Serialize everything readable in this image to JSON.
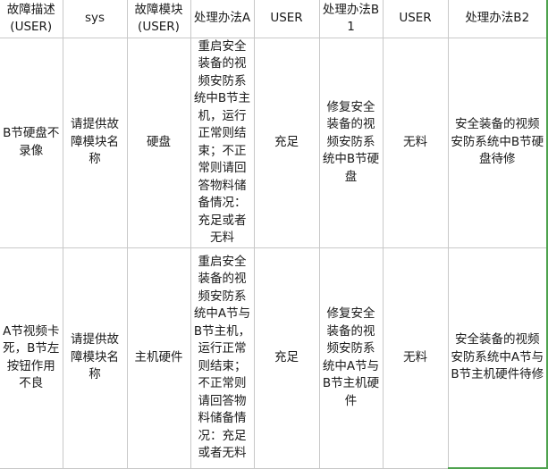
{
  "table": {
    "headers": [
      "故障描述(USER)",
      "sys",
      "故障模块(USER)",
      "处理办法A",
      "USER",
      "处理办法B1",
      "USER",
      "处理办法B2"
    ],
    "rows": [
      [
        "B节硬盘不录像",
        "请提供故障模块名称",
        "硬盘",
        "重启安全装备的视频安防系统中B节主机，运行正常则结束；不正常则请回答物料储备情况：充足或者无料",
        "充足",
        "修复安全装备的视频安防系统中B节硬盘",
        "无料",
        "安全装备的视频安防系统中B节硬盘待修"
      ],
      [
        "A节视频卡死，B节左按钮作用不良",
        "请提供故障模块名称",
        "主机硬件",
        "重启安全装备的视频安防系统中A节与B节主机，运行正常则结束；不正常则请回答物料储备情况：充足或者无料",
        "充足",
        "修复安全装备的视频安防系统中A节与B节主机硬件",
        "无料",
        "安全装备的视频安防系统中A节与B节主机硬件待修"
      ]
    ]
  },
  "colors": {
    "grid": "#c8c8c8",
    "selection": "#4ea24e"
  }
}
